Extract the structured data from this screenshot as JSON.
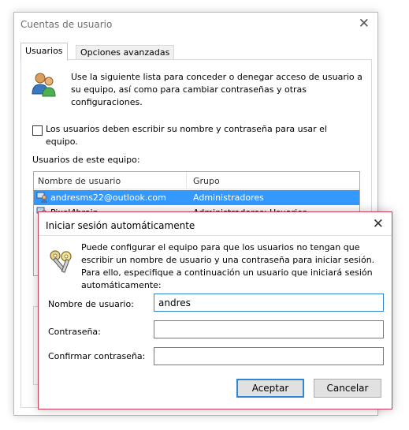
{
  "window": {
    "title": "Cuentas de usuario",
    "close_glyph": "✕"
  },
  "tabs": [
    {
      "label": "Usuarios",
      "active": true
    },
    {
      "label": "Opciones avanzadas",
      "active": false
    }
  ],
  "users_tab": {
    "intro": "Use la siguiente lista para conceder o denegar acceso de usuario a su equipo, así como para cambiar contraseñas y otras configuraciones.",
    "require_login_checkbox": {
      "label": "Los usuarios deben escribir su nombre y contraseña para usar el equipo.",
      "checked": false
    },
    "users_label": "Usuarios de este equipo:",
    "columns": [
      "Nombre de usuario",
      "Grupo"
    ],
    "users": [
      {
        "name": "andresms22@outlook.com",
        "group": "Administradores",
        "selected": true
      },
      {
        "name": "Pixel4brain",
        "group": "Administradores; Usuarios",
        "selected": false
      }
    ]
  },
  "dialog": {
    "title": "Iniciar sesión automáticamente",
    "close_glyph": "✕",
    "description": "Puede configurar el equipo para que los usuarios no tengan que escribir un nombre de usuario y una contraseña para iniciar sesión. Para ello, especifique a continuación un usuario que iniciará sesión automáticamente:",
    "username_label": "Nombre de usuario:",
    "username_value": "andres",
    "password_label": "Contraseña:",
    "password_value": "",
    "confirm_label": "Confirmar contraseña:",
    "confirm_value": "",
    "accept_label": "Aceptar",
    "cancel_label": "Cancelar"
  },
  "colors": {
    "selection": "#3399ff",
    "dialog_border": "#cd3b54",
    "focus_border": "#2f86d6"
  },
  "icons": [
    "users-icon",
    "user-icon",
    "keys-icon",
    "close-icon"
  ]
}
